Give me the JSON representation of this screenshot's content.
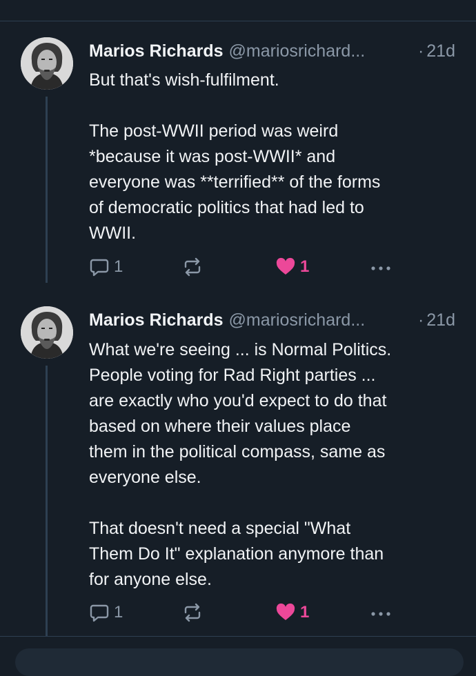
{
  "posts": [
    {
      "author_name": "Marios Richards",
      "handle": "@mariosrichard...",
      "separator": "·",
      "time": "21d",
      "text": "But that's wish-fulfilment.\n\nThe post-WWII period was weird\n*because it was post-WWII* and\neveryone was **terrified** of the forms\nof democratic politics that had led to\nWWII.",
      "reply_count": "1",
      "like_count": "1"
    },
    {
      "author_name": "Marios Richards",
      "handle": "@mariosrichard...",
      "separator": "·",
      "time": "21d",
      "text": "What we're seeing ... is Normal Politics.\nPeople voting for Rad Right parties ...\nare exactly who you'd expect to do that\nbased on where their values place\nthem in the political compass, same as\neveryone else.\n\nThat doesn't need a special \"What\nThem Do It\" explanation anymore than\nfor anyone else.",
      "reply_count": "1",
      "like_count": "1"
    }
  ],
  "colors": {
    "background": "#161e27",
    "divider": "#2e4052",
    "muted": "#8b98a7",
    "like": "#ec4899"
  },
  "icons": [
    "reply-icon",
    "repost-icon",
    "heart-icon",
    "more-icon"
  ]
}
